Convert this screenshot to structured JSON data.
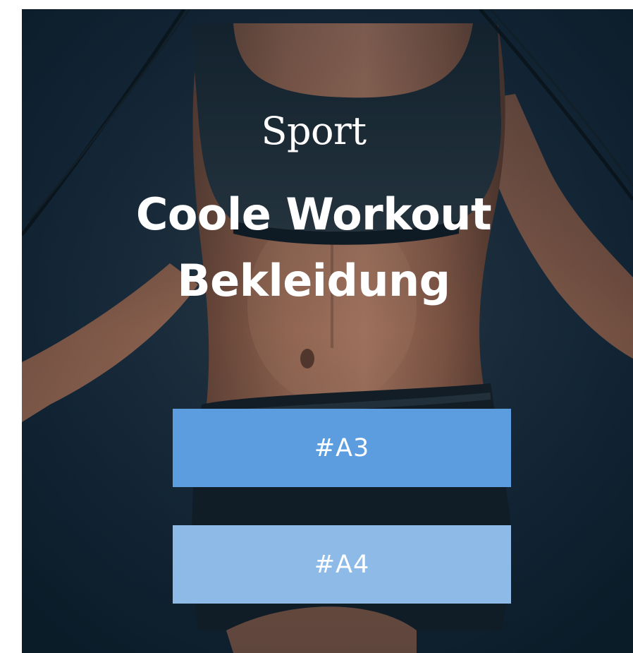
{
  "hero": {
    "eyebrow": "Sport",
    "headline_line1": "Coole Workout",
    "headline_line2": "Bekleidung",
    "image_subject": "athlete-jumping-rope-photo"
  },
  "buttons": [
    {
      "label": "#A3",
      "color": "#5b9ddf"
    },
    {
      "label": "#A4",
      "color": "#8dbae6"
    }
  ],
  "colors": {
    "background_dark": "#0f2331",
    "text": "#ffffff"
  }
}
